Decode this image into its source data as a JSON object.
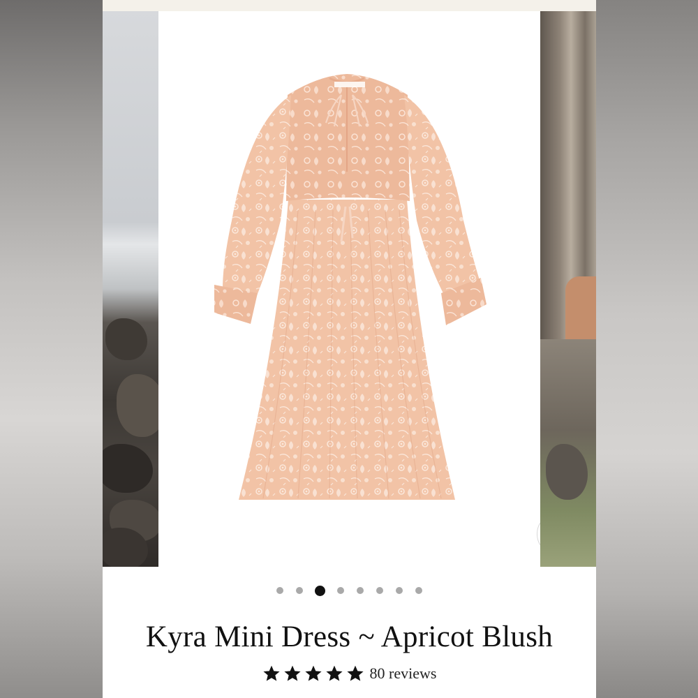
{
  "product": {
    "title": "Kyra Mini Dress ~ Apricot Blush",
    "rating": 5,
    "reviews_label": "80 reviews"
  },
  "gallery": {
    "dot_count": 8,
    "active_index": 2,
    "zoom_icon": "search-icon"
  },
  "colors": {
    "dress": "#f2c3a6",
    "print": "#fbe7da",
    "active_dot": "#111111",
    "dot": "#a9a9a9"
  }
}
